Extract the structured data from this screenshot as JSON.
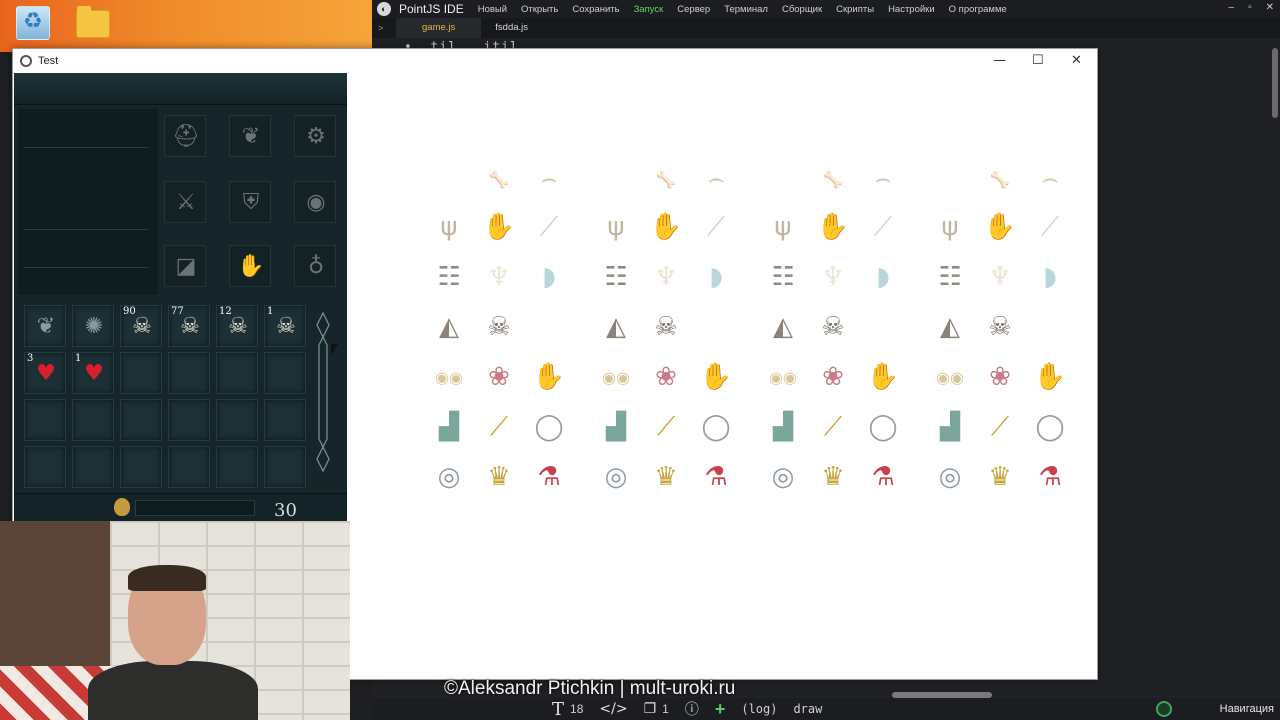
{
  "ide": {
    "title": "PointJS IDE",
    "menu": [
      "Новый",
      "Открыть",
      "Сохранить",
      "Запуск",
      "Сервер",
      "Терминал",
      "Сборщик",
      "Скрипты",
      "Настройки",
      "О программе"
    ],
    "tabs": [
      "game.js",
      "fsdda.js"
    ],
    "code_snippet": "• …til…  …itil…",
    "statusbar": {
      "font_size": "18",
      "pages": "1",
      "log_label": "(log)",
      "draw_label": "draw",
      "navigation_label": "Навигация"
    }
  },
  "test_window": {
    "title": "Test"
  },
  "inventory": {
    "slot_counts": [
      "90",
      "77",
      "12",
      "1",
      "3",
      "1"
    ],
    "gold": "30"
  },
  "watermark": "©Aleksandr Ptichkin | mult-uroki.ru",
  "colors": {
    "ide_bg": "#1f2125",
    "ide_active_menu": "#5fd45f",
    "ide_active_tab": "#e0b84a",
    "game_panel_bg": "#16252a",
    "window_bg": "#ffffff"
  },
  "sprite_rows": [
    [
      "",
      "bone-icon",
      "jaw-icon"
    ],
    [
      "claw-icon",
      "hand-bones-icon",
      "arm-bone-icon"
    ],
    [
      "ribcage-icon",
      "tooth-icon",
      "fang-icon"
    ],
    [
      "bird-skull-icon",
      "skull-icon",
      ""
    ],
    [
      "eyes-icon",
      "brain-icon",
      "zombie-hand-icon"
    ],
    [
      "zombie-foot-icon",
      "syringe-icon",
      "bracelet-icon"
    ],
    [
      "ring-icon",
      "crown-icon",
      "potion-icon"
    ]
  ]
}
